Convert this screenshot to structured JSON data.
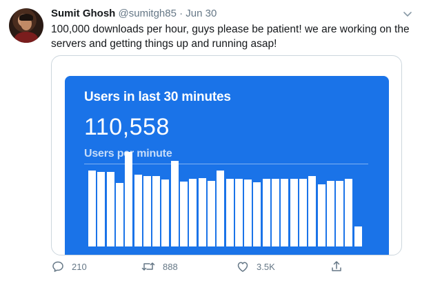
{
  "tweet": {
    "author_name": "Sumit Ghosh",
    "handle": "@sumitgh85",
    "separator": "·",
    "date": "Jun 30",
    "text": "100,000 downloads per hour, guys please be patient! we are working on the servers and getting things up and running asap!"
  },
  "card": {
    "title": "Users in last 30 minutes",
    "value": "110,558",
    "subtitle": "Users per minute",
    "background_color": "#1a73e8"
  },
  "chart_data": {
    "type": "bar",
    "title": "",
    "xlabel": "",
    "ylabel": "",
    "bar_color": "#ffffff",
    "values": [
      88,
      86,
      86,
      73,
      109,
      83,
      81,
      81,
      77,
      99,
      75,
      78,
      79,
      76,
      88,
      78,
      78,
      77,
      74,
      78,
      78,
      78,
      78,
      78,
      81,
      72,
      76,
      76,
      78,
      23
    ],
    "ylim": [
      0,
      110
    ]
  },
  "actions": {
    "replies": "210",
    "retweets": "888",
    "likes": "3.5K"
  },
  "icons": {
    "more": "chevron-down-icon",
    "reply": "comment-icon",
    "retweet": "retweet-icon",
    "like": "heart-icon",
    "share": "share-icon"
  }
}
